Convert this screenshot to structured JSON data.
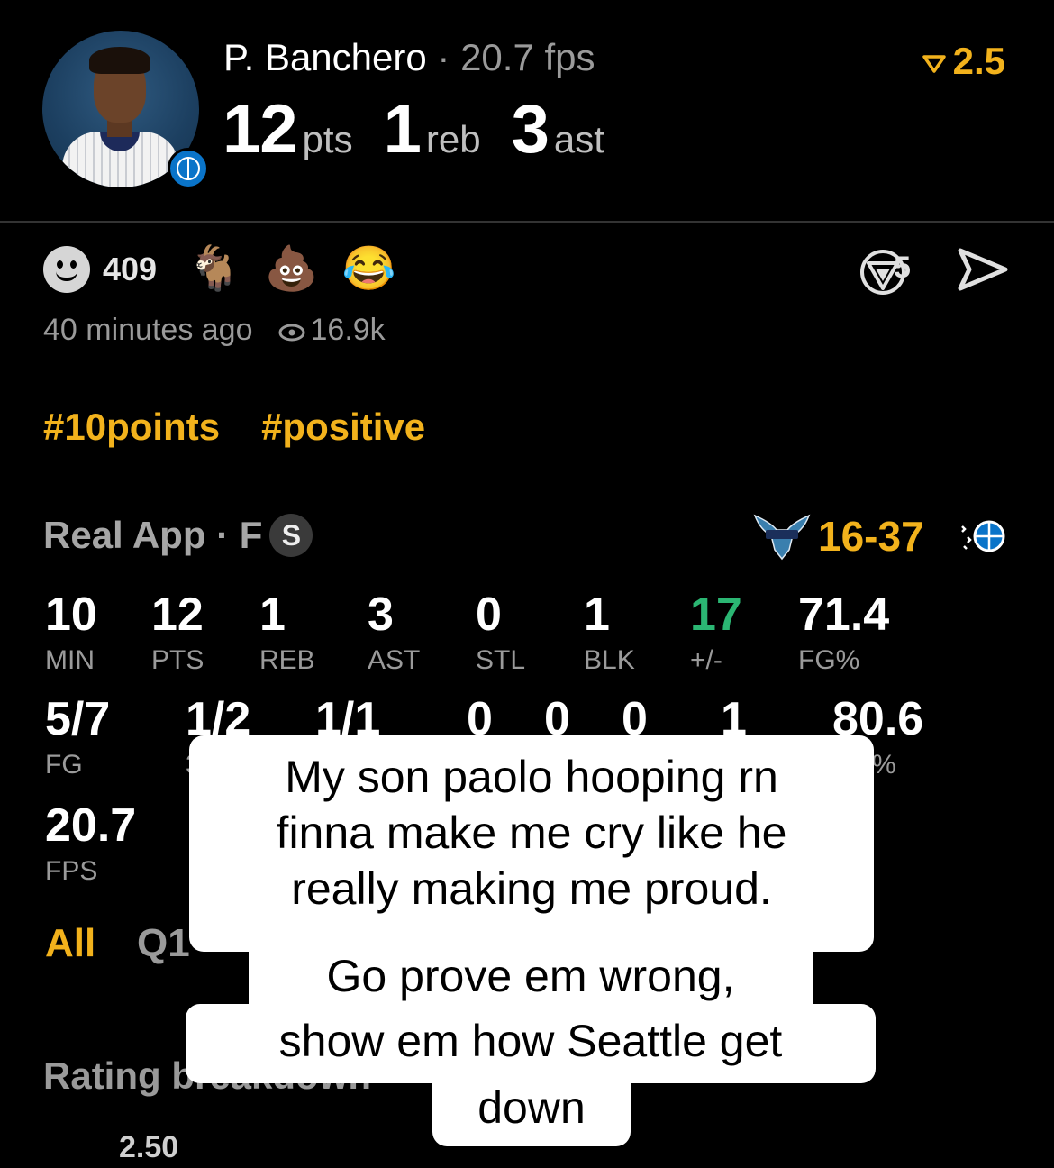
{
  "player": {
    "name": "P. Banchero",
    "separator": "·",
    "fps_text": "20.7 fps",
    "pts": "12",
    "pts_label": "pts",
    "reb": "1",
    "reb_label": "reb",
    "ast": "3",
    "ast_label": "ast",
    "rating": "2.5"
  },
  "reactions": {
    "count": "409",
    "emojis": [
      "🐐",
      "💩",
      "😂"
    ],
    "share_count": "5",
    "icons": [
      "smile-icon",
      "goat-emoji",
      "poop-emoji",
      "laugh-cry-emoji",
      "shield-icon",
      "send-icon",
      "eye-icon"
    ]
  },
  "meta": {
    "time": "40 minutes ago",
    "views": "16.9k"
  },
  "tags": [
    "#10points",
    "#positive"
  ],
  "game": {
    "title": "Real App · F",
    "badge": "S",
    "score_opp": "16-",
    "score_own": "37"
  },
  "stats_row1": [
    {
      "value": "10",
      "label": "MIN"
    },
    {
      "value": "12",
      "label": "PTS"
    },
    {
      "value": "1",
      "label": "REB"
    },
    {
      "value": "3",
      "label": "AST"
    },
    {
      "value": "0",
      "label": "STL"
    },
    {
      "value": "1",
      "label": "BLK"
    },
    {
      "value": "17",
      "label": "+/-"
    },
    {
      "value": "71.4",
      "label": "FG%"
    }
  ],
  "stats_row2": [
    {
      "value": "5/7",
      "label": "FG"
    },
    {
      "value": "1/2",
      "label": "3"
    },
    {
      "value": "1/1",
      "label": ""
    },
    {
      "value": "0",
      "label": ""
    },
    {
      "value": "0",
      "label": ""
    },
    {
      "value": "0",
      "label": ""
    },
    {
      "value": "1",
      "label": ""
    },
    {
      "value": "80.6",
      "label": "%"
    }
  ],
  "stats_row3": [
    {
      "value": "20.7",
      "label": "FPS"
    }
  ],
  "periods": {
    "all": "All",
    "q1": "Q1"
  },
  "rating_breakdown": {
    "title": "Rating breakdown",
    "value": "2.50"
  },
  "caption": [
    "My son paolo hooping rn",
    "finna make me cry like he",
    "really making me proud.",
    "Go prove em wrong,",
    "show em how Seattle get",
    "down"
  ],
  "colors": {
    "accent": "#f2b21c",
    "positive": "#2bb673",
    "muted": "#9a9a9a",
    "background": "#000000"
  }
}
